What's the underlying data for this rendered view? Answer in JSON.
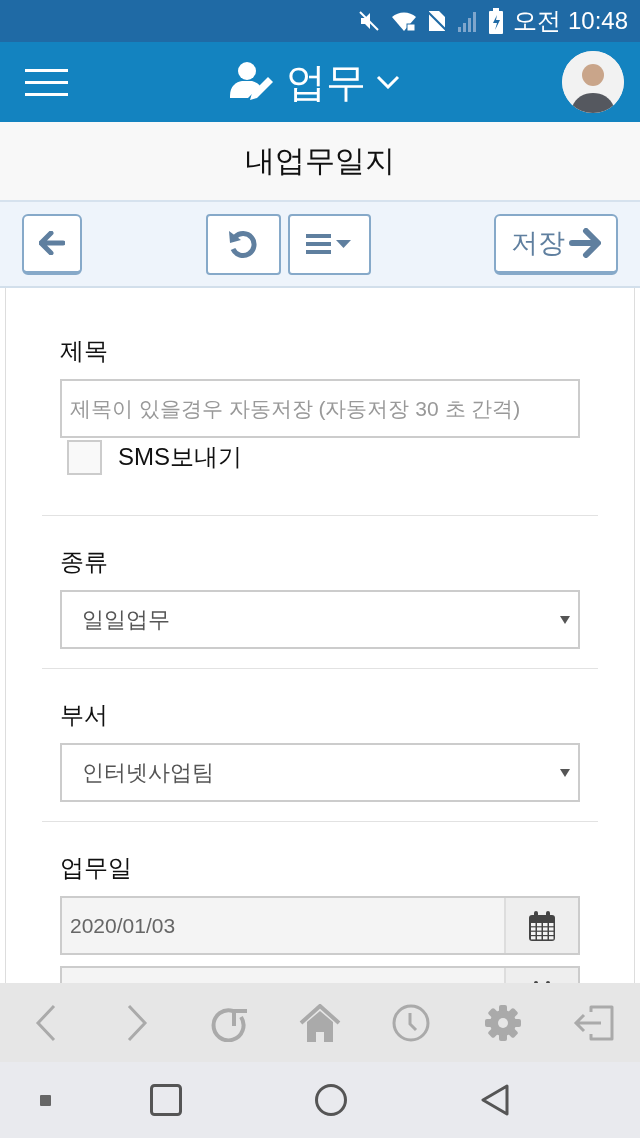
{
  "status_bar": {
    "time": "오전 10:48"
  },
  "header": {
    "title": "업무"
  },
  "page_title": "내업무일지",
  "toolbar": {
    "save_label": "저장"
  },
  "form": [
    {
      "kind": "text",
      "label": "제목",
      "placeholder": "제목이 있을경우 자동저장 (자동저장 30 초 간격)",
      "sms": {
        "label": "SMS보내기",
        "checked": false
      }
    },
    {
      "kind": "select",
      "label": "종류",
      "value": "일일업무"
    },
    {
      "kind": "select",
      "label": "부서",
      "value": "인터넷사업팀"
    },
    {
      "kind": "date",
      "label": "업무일",
      "dates": [
        "2020/01/03"
      ]
    }
  ]
}
